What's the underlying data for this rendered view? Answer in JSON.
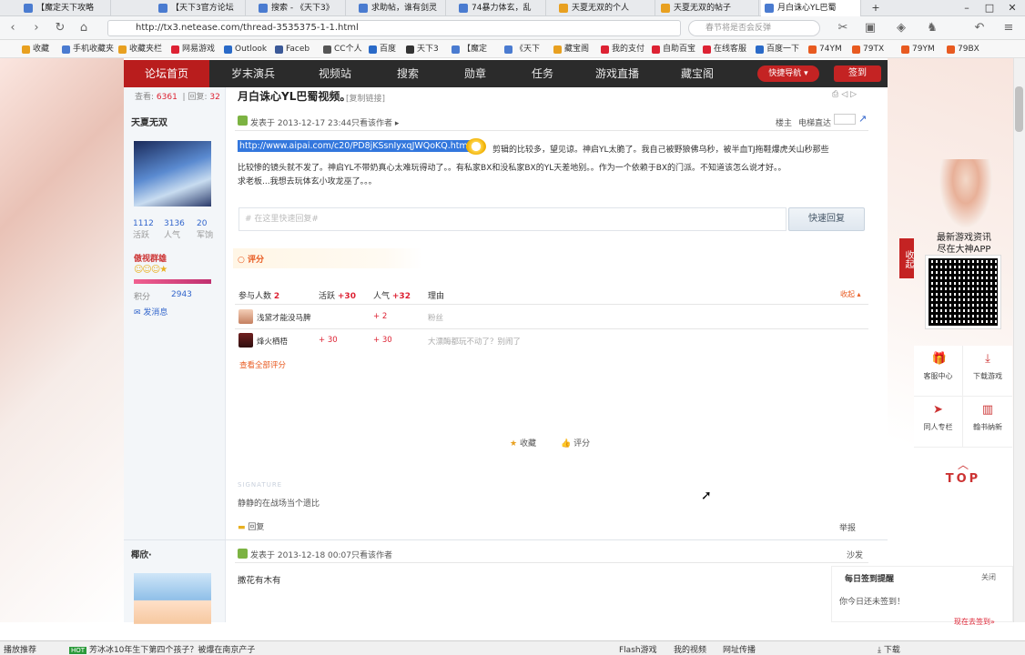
{
  "browser": {
    "tabs": [
      {
        "label": "【魔定天下攻略"
      },
      {
        "label": "【天下3官方论坛"
      },
      {
        "label": "搜索 - 《天下3》"
      },
      {
        "label": "求助帖，谁有剑灵"
      },
      {
        "label": "74暴力体玄，乱"
      },
      {
        "label": "天夏无双的个人"
      },
      {
        "label": "天夏无双的帖子"
      },
      {
        "label": "月白诛心YL巴蜀"
      }
    ],
    "new_tab": "+",
    "url": "http://tx3.netease.com/thread-3535375-1-1.html",
    "search_placeholder": "春节将是否会反弹",
    "bookmarks": [
      {
        "label": "收藏",
        "color": "#e8a020"
      },
      {
        "label": "手机收藏夹",
        "color": "#4a7bd0"
      },
      {
        "label": "收藏夹栏",
        "color": "#e8a020"
      },
      {
        "label": "网易游戏",
        "color": "#d23"
      },
      {
        "label": "Outlook",
        "color": "#2a6ac8"
      },
      {
        "label": "Faceb",
        "color": "#3b5998"
      },
      {
        "label": "CC个人",
        "color": "#555"
      },
      {
        "label": "百度",
        "color": "#2a6ac8"
      },
      {
        "label": "天下3",
        "color": "#333"
      },
      {
        "label": "【魔定",
        "color": "#4a7bd0"
      },
      {
        "label": "《天下",
        "color": "#4a7bd0"
      },
      {
        "label": "藏宝阁",
        "color": "#e8a020"
      },
      {
        "label": "我的支付",
        "color": "#d23"
      },
      {
        "label": "自助百宝",
        "color": "#d23"
      },
      {
        "label": "在线客服",
        "color": "#d23"
      },
      {
        "label": "百度一下",
        "color": "#2a6ac8"
      },
      {
        "label": "74YM",
        "color": "#e85a20"
      },
      {
        "label": "79TX",
        "color": "#e85a20"
      },
      {
        "label": "79YM",
        "color": "#e85a20"
      },
      {
        "label": "79BX",
        "color": "#e85a20"
      }
    ]
  },
  "nav": {
    "items": [
      "论坛首页",
      "岁末演兵",
      "视频站",
      "搜索",
      "勋章",
      "任务",
      "游戏直播",
      "藏宝阁"
    ],
    "quick_nav": "快捷导航",
    "signin": "签到"
  },
  "thread": {
    "views_label": "查看:",
    "views": "6361",
    "replies_label": "回复:",
    "replies": "32",
    "title": "月白诛心YL巴蜀视频。",
    "copy_link": "[复制链接]"
  },
  "post1": {
    "author": "天夏无双",
    "stats": [
      {
        "value": "1112",
        "label": "活跃"
      },
      {
        "value": "3136",
        "label": "人气"
      },
      {
        "value": "20",
        "label": "军饷"
      }
    ],
    "rank": "傲视群雄",
    "points_label": "积分",
    "points": "2943",
    "message_link": "发消息",
    "posted_at": "发表于 2013-12-17 23:44",
    "only_author": "只看该作者",
    "floor": "楼主",
    "elevator": "电梯直达",
    "link": "http://www.aipai.com/c20/PD8jKSsnIyxqJWQoKQ.html",
    "body_line1": "剪辑的比较多，望见谅。神启YL太脆了。我自己被野狼佛乌秒，被半血TJ拖鞋爆虎关山秒那些",
    "body_line2": "比较惨的镜头就不发了。神启YL不带奶真心太难玩得动了。。有私家BX和没私家BX的YL天差地别。。作为一个依赖于BX的门派。不知道该怎么说才好。。",
    "body_line3": "求老板...我想去玩体玄小攻龙巫了。。。",
    "reply_placeholder": "# 在这里快速回复#",
    "quick_reply": "快速回复",
    "rating_title": "评分",
    "rating_header": {
      "participants": "参与人数",
      "participants_count": "2",
      "active": "活跃",
      "active_total": "+30",
      "popularity": "人气",
      "popularity_total": "+32",
      "reason": "理由",
      "collapse": "收起"
    },
    "ratings": [
      {
        "user": "浅黛才能没马脾",
        "active": "",
        "popularity": "+ 2",
        "reason": "粉丝"
      },
      {
        "user": "烽火栖梧",
        "active": "+ 30",
        "popularity": "+ 30",
        "reason": "大漂酶都玩不动了？别闹了"
      }
    ],
    "view_all": "查看全部评分",
    "favorite": "收藏",
    "rate": "评分",
    "signature_label": "SIGNATURE",
    "signature": "静静的在战场当个遗比",
    "reply": "回复",
    "report": "举报"
  },
  "post2": {
    "author": "椰欣·",
    "posted_at": "发表于 2013-12-18 00:07",
    "only_author": "只看该作者",
    "floor": "沙发",
    "body": "撒花有木有"
  },
  "right_panel": {
    "collapse": "收起",
    "promo_line1": "最新游戏资讯",
    "promo_line2": "尽在大神APP",
    "items": [
      {
        "label": "客服中心",
        "icon": "gift-icon"
      },
      {
        "label": "下载游戏",
        "icon": "download-icon"
      },
      {
        "label": "同人专栏",
        "icon": "send-icon"
      },
      {
        "label": "翰书纳新",
        "icon": "book-icon"
      }
    ],
    "top": "TOP",
    "sign_title": "每日签到提醒",
    "sign_close": "关闭",
    "sign_status": "你今日还未签到！",
    "sign_now": "现在去签到»"
  },
  "taskbar": {
    "left": "播放推荐",
    "news": "芳冰冰10年生下第四个孩子？被爆在南京产子",
    "items": [
      "Flash游戏",
      "我的视频",
      "网址传播"
    ],
    "download": "下载"
  }
}
